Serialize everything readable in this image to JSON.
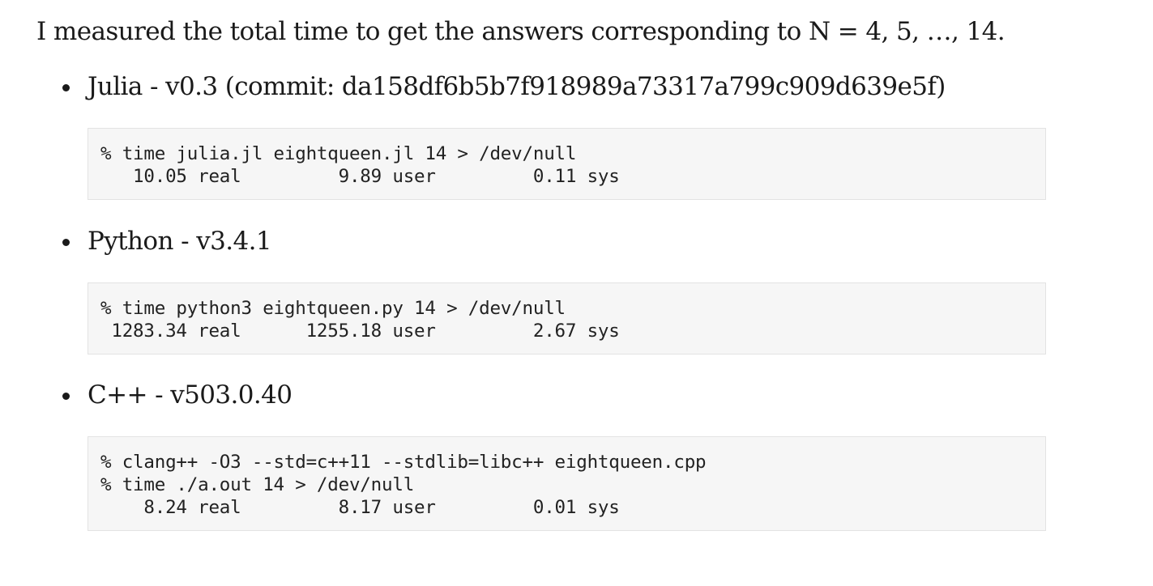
{
  "intro_text": "I measured the total time to get the answers corresponding to N = 4, 5, …, 14.",
  "items": [
    {
      "title": "Julia - v0.3 (commit: da158df6b5b7f918989a73317a799c909d639e5f)",
      "code_lines": [
        "% time julia.jl eightqueen.jl 14 > /dev/null",
        "   10.05 real         9.89 user         0.11 sys"
      ]
    },
    {
      "title": "Python - v3.4.1",
      "code_lines": [
        "% time python3 eightqueen.py 14 > /dev/null",
        " 1283.34 real      1255.18 user         2.67 sys"
      ]
    },
    {
      "title": "C++ - v503.0.40",
      "code_lines": [
        "% clang++ -O3 --std=c++11 --stdlib=libc++ eightqueen.cpp",
        "% time ./a.out 14 > /dev/null",
        "    8.24 real         8.17 user         0.01 sys"
      ]
    }
  ]
}
